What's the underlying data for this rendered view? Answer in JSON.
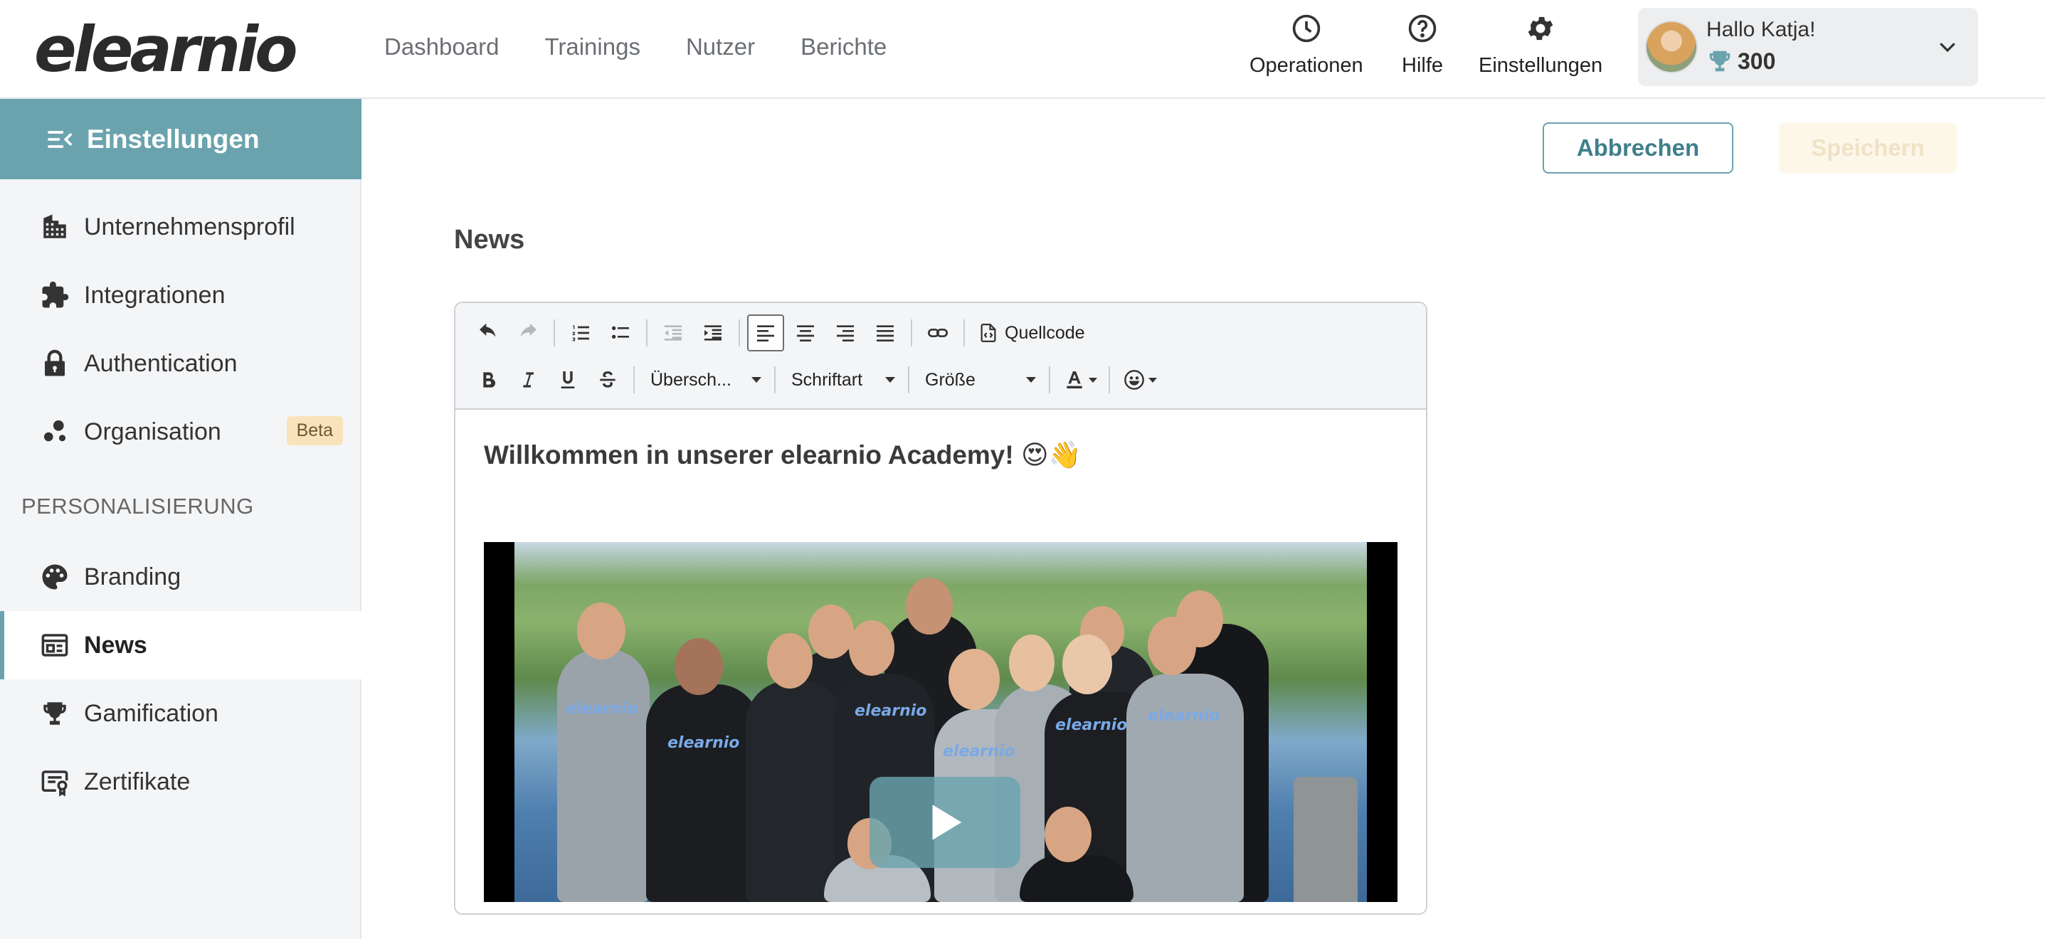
{
  "app": {
    "logo": "elearnio",
    "nav": [
      "Dashboard",
      "Trainings",
      "Nutzer",
      "Berichte"
    ],
    "tools": {
      "operations": "Operationen",
      "help": "Hilfe",
      "settings": "Einstellungen"
    },
    "user": {
      "greeting": "Hallo Katja!",
      "points": "300"
    }
  },
  "sidebar": {
    "header": "Einstellungen",
    "items": [
      {
        "label": "Unternehmensprofil",
        "icon": "building-icon"
      },
      {
        "label": "Integrationen",
        "icon": "puzzle-icon"
      },
      {
        "label": "Authentication",
        "icon": "lock-icon"
      },
      {
        "label": "Organisation",
        "icon": "organisation-icon",
        "badge": "Beta"
      }
    ],
    "section_label": "PERSONALISIERUNG",
    "items2": [
      {
        "label": "Branding",
        "icon": "palette-icon"
      },
      {
        "label": "News",
        "icon": "news-icon",
        "active": true
      },
      {
        "label": "Gamification",
        "icon": "trophy-icon"
      },
      {
        "label": "Zertifikate",
        "icon": "certificate-icon"
      }
    ]
  },
  "actions": {
    "cancel": "Abbrechen",
    "save": "Speichern"
  },
  "page": {
    "title": "News"
  },
  "editor": {
    "toolbar": {
      "source": "Quellcode",
      "heading": "Übersch...",
      "font": "Schriftart",
      "size": "Größe"
    },
    "content": {
      "heading": "Willkommen in unserer elearnio Academy! 😍👋"
    }
  },
  "colors": {
    "accent": "#6aa3ae",
    "badge_bg": "#f9e3bb",
    "save_disabled_bg": "#fdf7ea"
  }
}
